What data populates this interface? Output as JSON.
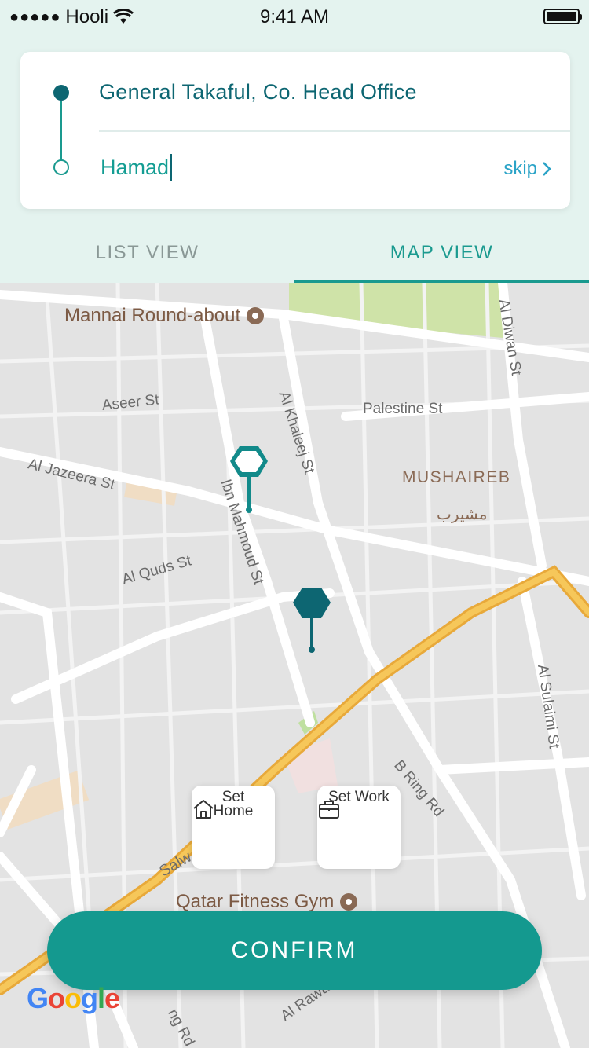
{
  "status_bar": {
    "carrier": "Hooli",
    "time": "9:41 AM"
  },
  "search": {
    "origin": "General Takaful, Co. Head Office",
    "destination": "Hamad",
    "skip_label": "skip"
  },
  "tabs": {
    "list": "LIST VIEW",
    "map": "MAP VIEW",
    "active": "map"
  },
  "map": {
    "pois": {
      "mannai": "Mannai Round-about",
      "gym": "Qatar Fitness Gym"
    },
    "district": "MUSHAIREB",
    "district_arabic": "مشيرب",
    "streets": {
      "al_diwan": "Al Diwan St",
      "aseer": "Aseer St",
      "palestine": "Palestine St",
      "al_khaleej": "Al Khaleej St",
      "al_jazeera": "Al Jazeera St",
      "ibn_mahmoud": "Ibn Mahmoud St",
      "al_quds": "Al Quds St",
      "al_sulaimi": "Al Sulaimi St",
      "b_ring": "B Ring Rd",
      "salwa": "Salw",
      "al_rawa": "Al Rawa",
      "ring": "ng Rd"
    },
    "google_logo": "Google"
  },
  "quick_actions": {
    "home": "Set Home",
    "work": "Set Work"
  },
  "confirm_label": "CONFIRM",
  "colors": {
    "primary": "#14998f",
    "dark_teal": "#0d6672",
    "link": "#2aa3c7",
    "header_bg": "#e4f3ef"
  }
}
